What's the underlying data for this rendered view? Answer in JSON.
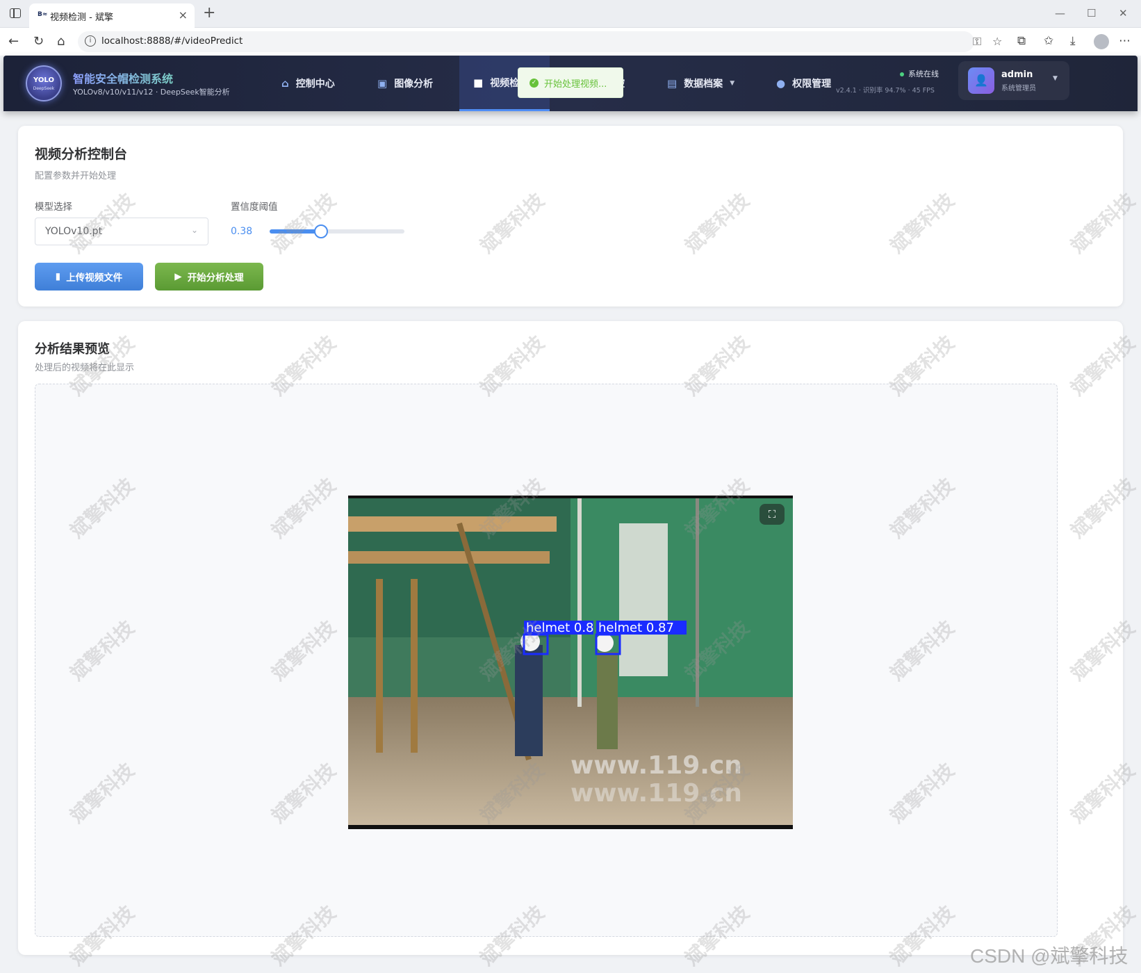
{
  "browser": {
    "tab_favicon": "B≈",
    "tab_title": "视频检测 - 斌擎",
    "url": "localhost:8888/#/videoPredict"
  },
  "header": {
    "logo_text": "YOLO",
    "logo_sub": "DeepSeek",
    "title": "智能安全帽检测系统",
    "subtitle": "YOLOv8/v10/v11/v12 · DeepSeek智能分析",
    "menu": [
      {
        "label": "控制中心",
        "icon": "home-icon"
      },
      {
        "label": "图像分析",
        "icon": "image-icon"
      },
      {
        "label": "视频检",
        "icon": "video-icon",
        "active": true
      },
      {
        "label": "控",
        "icon": "camera-icon"
      },
      {
        "label": "数据档案",
        "icon": "document-icon"
      },
      {
        "label": "权限管理",
        "icon": "user-icon"
      }
    ],
    "status": "系统在线",
    "meta": "v2.4.1 · 识别率 94.7% · 45 FPS",
    "user_name": "admin",
    "user_role": "系统管理员"
  },
  "toast": {
    "message": "开始处理视频...",
    "color": "#67c23a"
  },
  "console": {
    "title": "视频分析控制台",
    "subtitle": "配置参数并开始处理",
    "model_label": "模型选择",
    "model_value": "YOLOv10.pt",
    "confidence_label": "置信度阈值",
    "confidence_value": "0.38",
    "confidence_fraction": 0.38,
    "upload_button": "上传视频文件",
    "start_button": "开始分析处理"
  },
  "preview": {
    "title": "分析结果预览",
    "subtitle": "处理后的视频将在此显示",
    "detections": [
      {
        "label": "helmet 0.8"
      },
      {
        "label": "helmet 0.87"
      }
    ],
    "video_watermark_1": "www.119.cn",
    "video_watermark_2": "www.119.cn"
  },
  "watermark": "斌擎科技",
  "credit": "CSDN @斌擎科技",
  "colors": {
    "accent": "#4a8ef0",
    "success": "#67c23a",
    "header_bg": "#1c2238",
    "detection_box": "#1a2cff"
  }
}
